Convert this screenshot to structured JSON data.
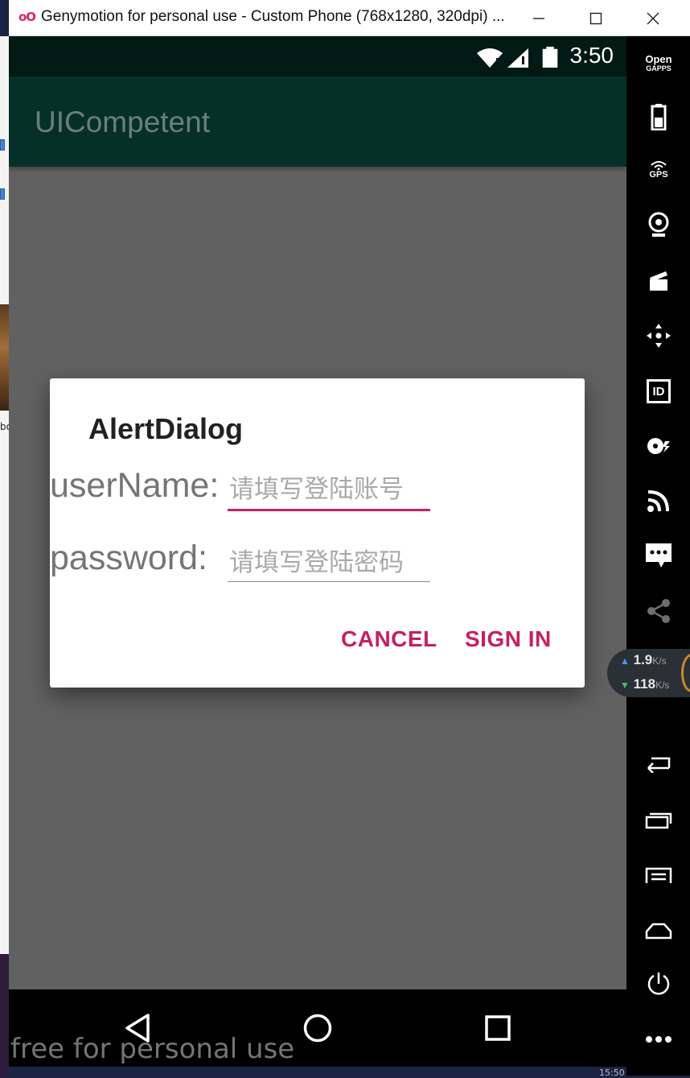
{
  "window": {
    "title": "Genymotion for personal use - Custom Phone (768x1280, 320dpi) ...",
    "logo": "oO",
    "minimize_label": "—",
    "maximize_label": "☐",
    "close_label": "✕"
  },
  "desktop": {
    "left_text": "bo"
  },
  "statusbar": {
    "time": "3:50"
  },
  "appbar": {
    "title": "UICompetent"
  },
  "dialog": {
    "title": "AlertDialog",
    "username_label": "userName:",
    "username_placeholder": "请填写登陆账号",
    "password_label": "password:",
    "password_placeholder": "请填写登陆密码",
    "cancel_label": "CANCEL",
    "signin_label": "SIGN IN",
    "accent_color": "#c71f63"
  },
  "watermark": "free for personal use",
  "sidebar": {
    "open_gapps_line1": "Open",
    "open_gapps_line2": "GAPPS",
    "gps_label": "GPS",
    "id_label": "ID",
    "items": [
      "open-gapps",
      "battery",
      "gps",
      "webcam",
      "screencast",
      "remote-control",
      "device-id",
      "disk-io",
      "cast",
      "sms",
      "share",
      "back",
      "recent-apps",
      "menu",
      "home",
      "power",
      "more"
    ]
  },
  "netmon": {
    "upload": "1.9",
    "upload_unit": "K/s",
    "download": "118",
    "download_unit": "K/s"
  },
  "taskbar": {
    "clock": "15:50"
  }
}
